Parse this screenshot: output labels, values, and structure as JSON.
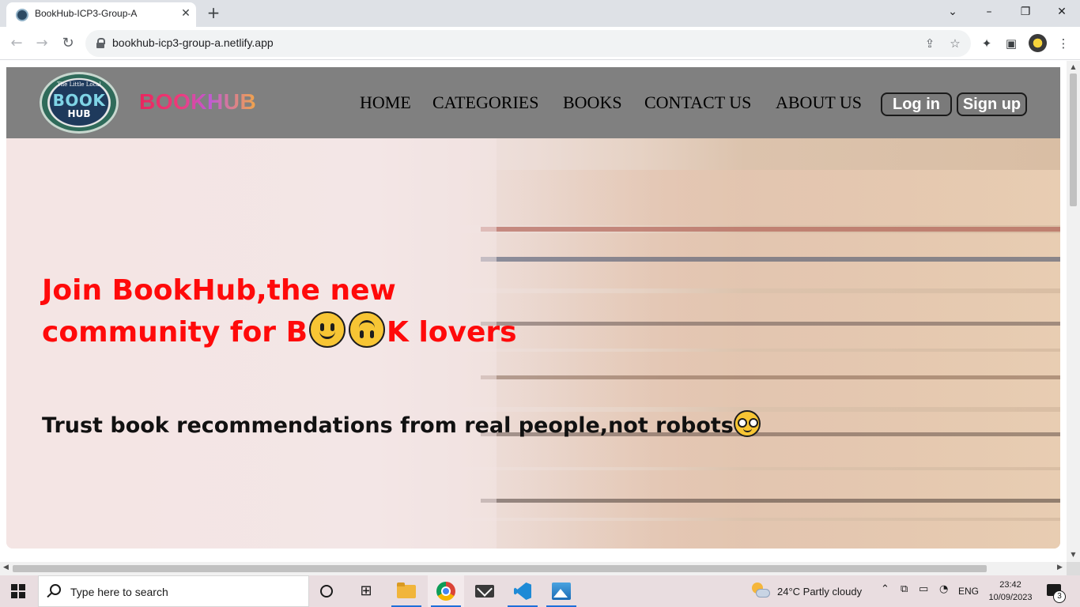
{
  "browser": {
    "tab_title": "BookHub-ICP3-Group-A",
    "url": "bookhub-icp3-group-a.netlify.app",
    "icons": [
      "back-arrow-icon",
      "forward-arrow-icon",
      "reload-icon",
      "lock-icon",
      "share-icon",
      "star-icon",
      "extensions-icon",
      "side-panel-icon",
      "profile-avatar",
      "kebab-menu-icon"
    ]
  },
  "site": {
    "logo": {
      "arc_text": "The Little Local",
      "word1": "BOOK",
      "word2": "HUB"
    },
    "brand": "BOOKHUB",
    "nav": [
      "HOME",
      "CATEGORIES",
      "BOOKS",
      "CONTACT US",
      "ABOUT US"
    ],
    "login_label": "Log in",
    "signup_label": "Sign up",
    "colors": {
      "header_bg": "#808080",
      "headline": "#ff0a0a",
      "subline": "#111111"
    }
  },
  "hero": {
    "line1": "Join BookHub,the new",
    "line2_prefix": "community for B",
    "line2_suffix": "K lovers",
    "emoji1": "slightly-smiling-face",
    "emoji2": "upside-down-face",
    "subline": "Trust book recommendations from real people,not robots",
    "subline_emoji": "nerd-face"
  },
  "taskbar": {
    "search_placeholder": "Type here to search",
    "weather": "24°C  Partly cloudy",
    "language": "ENG",
    "time": "23:42",
    "date": "10/09/2023",
    "notifications": "3"
  }
}
